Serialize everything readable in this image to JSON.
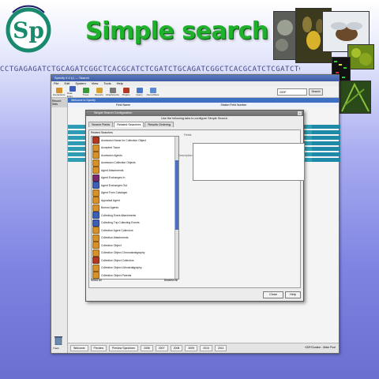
{
  "headline": "Simple search",
  "logo_text": "Sp",
  "dna_text": "CCTGAGAGATCTGCAGATCGGCTCACGCATCTCGATCTGCAGATCGGCTCACGCATCTCGATCTGCAGATCGGCTCACGC",
  "colors": {
    "headline": "#1fb02c",
    "logo": "#1a8a6e",
    "title_blue": "#3d6fc2",
    "row_teal": "#2e9db4"
  },
  "app": {
    "title": "Specify 6.0 (r) — Search",
    "menu": [
      "File",
      "Edit",
      "System",
      "View",
      "Tools",
      "Help"
    ],
    "toolbar": [
      {
        "label": "Interactions",
        "icon": "interactions-icon"
      },
      {
        "label": "Data Entry",
        "icon": "data-entry-icon"
      },
      {
        "label": "Trees",
        "icon": "trees-icon"
      },
      {
        "label": "Reports",
        "icon": "reports-icon"
      },
      {
        "label": "Attachments",
        "icon": "attachments-icon"
      },
      {
        "label": "Plugins",
        "icon": "plugins-icon"
      },
      {
        "label": "Query",
        "icon": "query-icon"
      },
      {
        "label": "RecordSets",
        "icon": "recordsets-icon"
      }
    ],
    "search_value": "GDF",
    "search_button": "Search",
    "left_header": "Record Sets",
    "left_item": "Trash",
    "main_header": "Welcome to Specify",
    "col_header_left": "Field Name",
    "col_header_right": "Station Field Number",
    "status_tabs": [
      "Welcome",
      "Preview",
      "Preview Specimen",
      "2006",
      "2007",
      "2008",
      "2009",
      "2010",
      "2011"
    ],
    "status_text": "GDF/Curator - Main Pool"
  },
  "dialog": {
    "title": "Simple Search Configuration",
    "instruction": "Use the following tabs to configure Simple Search.",
    "tabs": [
      "Search Fields",
      "Related Searches",
      "Results Ordering"
    ],
    "active_tab": "Related Searches",
    "list_header": "Related Searches",
    "items": [
      "Accession Name for Collection Object",
      "Accepted Taxon",
      "Accession Agents",
      "Accession Collection Objects",
      "Agent Attachments",
      "Agent Exchanges In",
      "Agent Exchanges Out",
      "Agent From Cataloger",
      "Appraisal Agent",
      "Borrow Agents",
      "Collecting Event Attachments",
      "Collecting Trip Collecting Events",
      "Collection Agent Collectors",
      "Collection Attachments",
      "Collection Object",
      "Collection Object Chronostratigraphy",
      "Collection Object Collectors",
      "Collection Object Lithostratigraphy",
      "Collection Object Parents"
    ],
    "item_colors": [
      "#b23a24",
      "#d6912a",
      "#d6912a",
      "#d6912a",
      "#d6912a",
      "#7a2a6a",
      "#3d5fb5",
      "#d6912a",
      "#d6912a",
      "#d6912a",
      "#3d5fb5",
      "#3d5fb5",
      "#d6912a",
      "#d6912a",
      "#d6912a",
      "#d6912a",
      "#b23a24",
      "#d6912a",
      "#d6912a"
    ],
    "select_all": "Select All",
    "deselect_all": "Deselect All",
    "label_fields": "Fields",
    "label_description": "Description",
    "close_button": "Close",
    "help_button": "Help"
  }
}
